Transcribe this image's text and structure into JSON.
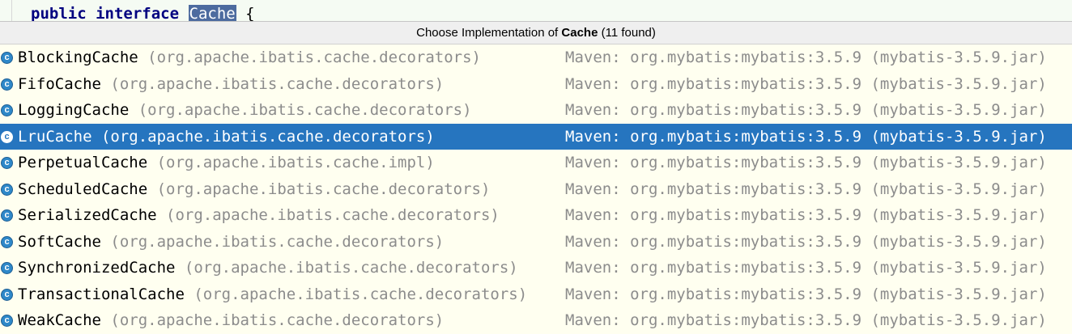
{
  "editor": {
    "kw_public": "public",
    "kw_interface": "interface",
    "identifier": "Cache",
    "brace": "{"
  },
  "popup": {
    "title_prefix": "Choose Implementation of ",
    "title_target": "Cache",
    "title_suffix": " (11 found)",
    "icon_glyph": "c",
    "selected_index": 3,
    "items": [
      {
        "name": "BlockingCache",
        "package": "(org.apache.ibatis.cache.decorators)",
        "location": "Maven: org.mybatis:mybatis:3.5.9 (mybatis-3.5.9.jar)"
      },
      {
        "name": "FifoCache",
        "package": "(org.apache.ibatis.cache.decorators)",
        "location": "Maven: org.mybatis:mybatis:3.5.9 (mybatis-3.5.9.jar)"
      },
      {
        "name": "LoggingCache",
        "package": "(org.apache.ibatis.cache.decorators)",
        "location": "Maven: org.mybatis:mybatis:3.5.9 (mybatis-3.5.9.jar)"
      },
      {
        "name": "LruCache",
        "package": "(org.apache.ibatis.cache.decorators)",
        "location": "Maven: org.mybatis:mybatis:3.5.9 (mybatis-3.5.9.jar)"
      },
      {
        "name": "PerpetualCache",
        "package": "(org.apache.ibatis.cache.impl)",
        "location": "Maven: org.mybatis:mybatis:3.5.9 (mybatis-3.5.9.jar)"
      },
      {
        "name": "ScheduledCache",
        "package": "(org.apache.ibatis.cache.decorators)",
        "location": "Maven: org.mybatis:mybatis:3.5.9 (mybatis-3.5.9.jar)"
      },
      {
        "name": "SerializedCache",
        "package": "(org.apache.ibatis.cache.decorators)",
        "location": "Maven: org.mybatis:mybatis:3.5.9 (mybatis-3.5.9.jar)"
      },
      {
        "name": "SoftCache",
        "package": "(org.apache.ibatis.cache.decorators)",
        "location": "Maven: org.mybatis:mybatis:3.5.9 (mybatis-3.5.9.jar)"
      },
      {
        "name": "SynchronizedCache",
        "package": "(org.apache.ibatis.cache.decorators)",
        "location": "Maven: org.mybatis:mybatis:3.5.9 (mybatis-3.5.9.jar)"
      },
      {
        "name": "TransactionalCache",
        "package": "(org.apache.ibatis.cache.decorators)",
        "location": "Maven: org.mybatis:mybatis:3.5.9 (mybatis-3.5.9.jar)"
      },
      {
        "name": "WeakCache",
        "package": "(org.apache.ibatis.cache.decorators)",
        "location": "Maven: org.mybatis:mybatis:3.5.9 (mybatis-3.5.9.jar)"
      }
    ]
  },
  "colors": {
    "selection": "#2675bf",
    "popup_background": "#fffff0",
    "header_background": "#efefef",
    "secondary_text": "#8c8c8c",
    "class_icon": "#2e88c9"
  }
}
